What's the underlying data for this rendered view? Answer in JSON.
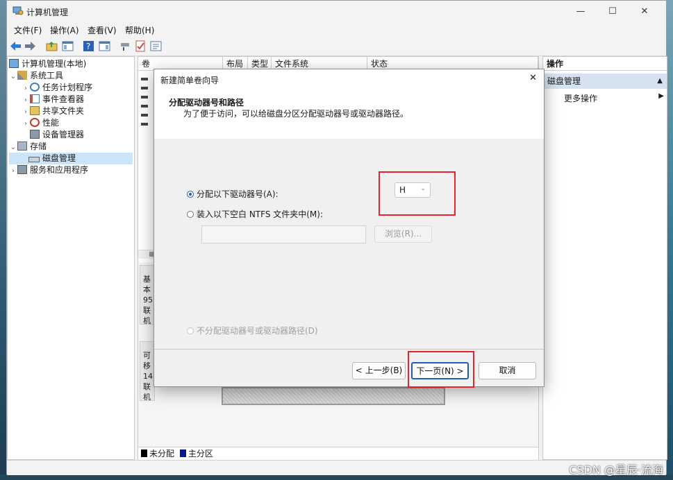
{
  "window": {
    "title": "计算机管理",
    "minimize": "—",
    "maximize": "☐",
    "close": "✕"
  },
  "menu": [
    "文件(F)",
    "操作(A)",
    "查看(V)",
    "帮助(H)"
  ],
  "tree": {
    "root": "计算机管理(本地)",
    "system_tools": "系统工具",
    "task_scheduler": "任务计划程序",
    "event_viewer": "事件查看器",
    "shared_folders": "共享文件夹",
    "performance": "性能",
    "device_manager": "设备管理器",
    "storage": "存储",
    "disk_management": "磁盘管理",
    "services_apps": "服务和应用程序"
  },
  "volume_table": {
    "columns": [
      "卷",
      "布局",
      "类型",
      "文件系统",
      "状态"
    ]
  },
  "disk_panels": [
    {
      "l1": "基本",
      "l2": "95",
      "l3": "联机"
    },
    {
      "l1": "可移",
      "l2": "14",
      "l3": "联机"
    }
  ],
  "legend": {
    "unallocated": "未分配",
    "primary": "主分区"
  },
  "actions": {
    "header": "操作",
    "section": "磁盘管理",
    "more": "更多操作"
  },
  "dialog": {
    "title": "新建简单卷向导",
    "close": "✕",
    "heading": "分配驱动器号和路径",
    "subheading": "为了便于访问，可以给磁盘分区分配驱动器号或驱动器路径。",
    "opt_assign": "分配以下驱动器号(A):",
    "opt_mount": "装入以下空白 NTFS 文件夹中(M):",
    "opt_none": "不分配驱动器号或驱动器路径(D)",
    "drive_letter": "H",
    "browse": "浏览(R)...",
    "back": "< 上一步(B)",
    "next": "下一页(N) >",
    "cancel": "取消"
  },
  "watermark": "CSDN @星辰·流海",
  "colors": {
    "accent": "#1a5fb4",
    "highlight_box": "#e3242b"
  }
}
